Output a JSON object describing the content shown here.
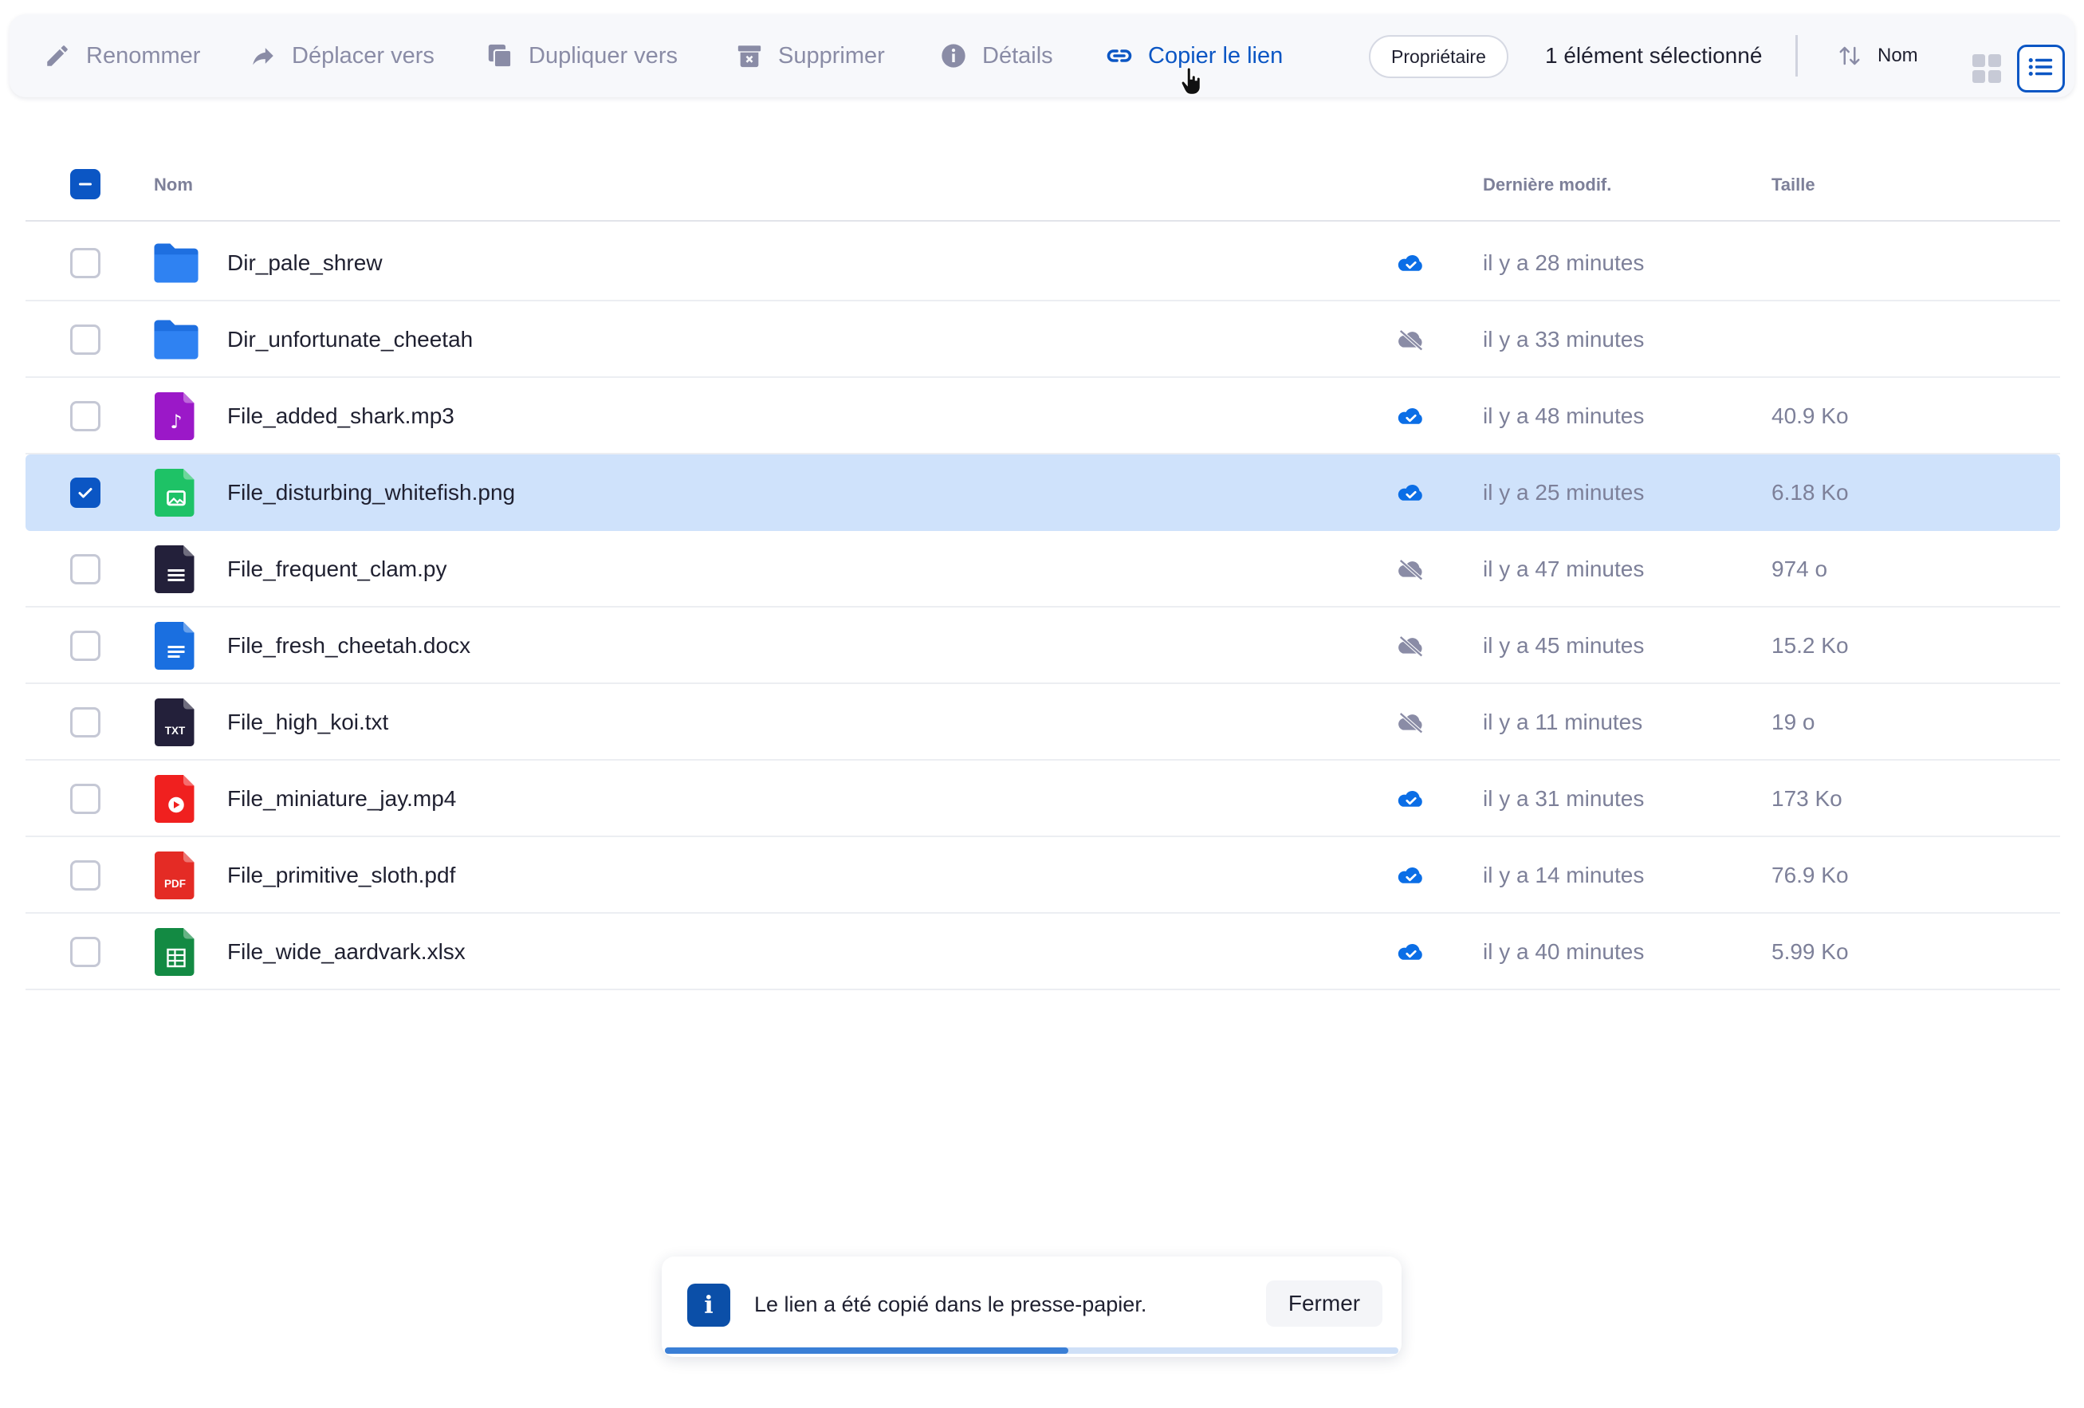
{
  "toolbar": {
    "rename": "Renommer",
    "move": "Déplacer vers",
    "duplicate": "Dupliquer vers",
    "delete": "Supprimer",
    "details": "Détails",
    "copy_link": "Copier le lien",
    "owner_chip": "Propriétaire",
    "selection_count": "1 élément sélectionné",
    "sort_label": "Nom",
    "active_view": "list"
  },
  "table": {
    "columns": {
      "name": "Nom",
      "modified": "Dernière modif.",
      "size": "Taille"
    },
    "header_checkbox": "partial",
    "rows": [
      {
        "name": "Dir_pale_shrew",
        "type": "folder",
        "synced": true,
        "modified": "il y a 28 minutes",
        "size": "",
        "selected": false
      },
      {
        "name": "Dir_unfortunate_cheetah",
        "type": "folder",
        "synced": false,
        "modified": "il y a 33 minutes",
        "size": "",
        "selected": false
      },
      {
        "name": "File_added_shark.mp3",
        "type": "audio",
        "synced": true,
        "modified": "il y a 48 minutes",
        "size": "40.9 Ko",
        "selected": false
      },
      {
        "name": "File_disturbing_whitefish.png",
        "type": "image",
        "synced": true,
        "modified": "il y a 25 minutes",
        "size": "6.18 Ko",
        "selected": true
      },
      {
        "name": "File_frequent_clam.py",
        "type": "code",
        "synced": false,
        "modified": "il y a 47 minutes",
        "size": "974 o",
        "selected": false
      },
      {
        "name": "File_fresh_cheetah.docx",
        "type": "doc",
        "synced": false,
        "modified": "il y a 45 minutes",
        "size": "15.2 Ko",
        "selected": false
      },
      {
        "name": "File_high_koi.txt",
        "type": "txt",
        "synced": false,
        "modified": "il y a 11 minutes",
        "size": "19 o",
        "selected": false
      },
      {
        "name": "File_miniature_jay.mp4",
        "type": "video",
        "synced": true,
        "modified": "il y a 31 minutes",
        "size": "173 Ko",
        "selected": false
      },
      {
        "name": "File_primitive_sloth.pdf",
        "type": "pdf",
        "synced": true,
        "modified": "il y a 14 minutes",
        "size": "76.9 Ko",
        "selected": false
      },
      {
        "name": "File_wide_aardvark.xlsx",
        "type": "sheet",
        "synced": true,
        "modified": "il y a 40 minutes",
        "size": "5.99 Ko",
        "selected": false
      }
    ]
  },
  "file_icons": {
    "txt_label": "TXT",
    "pdf_label": "PDF"
  },
  "toast": {
    "message": "Le lien a été copié dans le presse-papier.",
    "close_label": "Fermer",
    "progress": 0.55
  },
  "colors": {
    "accent": "#0b56c4",
    "selected_row": "#cfe2fb",
    "cloud_synced": "#0b6ee6",
    "cloud_offline": "#8a8ca6",
    "folder": "#1e6fe0",
    "audio": "#9b18c8",
    "image": "#1ec266",
    "code": "#23203a",
    "doc": "#1a6fe0",
    "video": "#f0201f",
    "pdf": "#e42b25",
    "sheet": "#138a43"
  }
}
